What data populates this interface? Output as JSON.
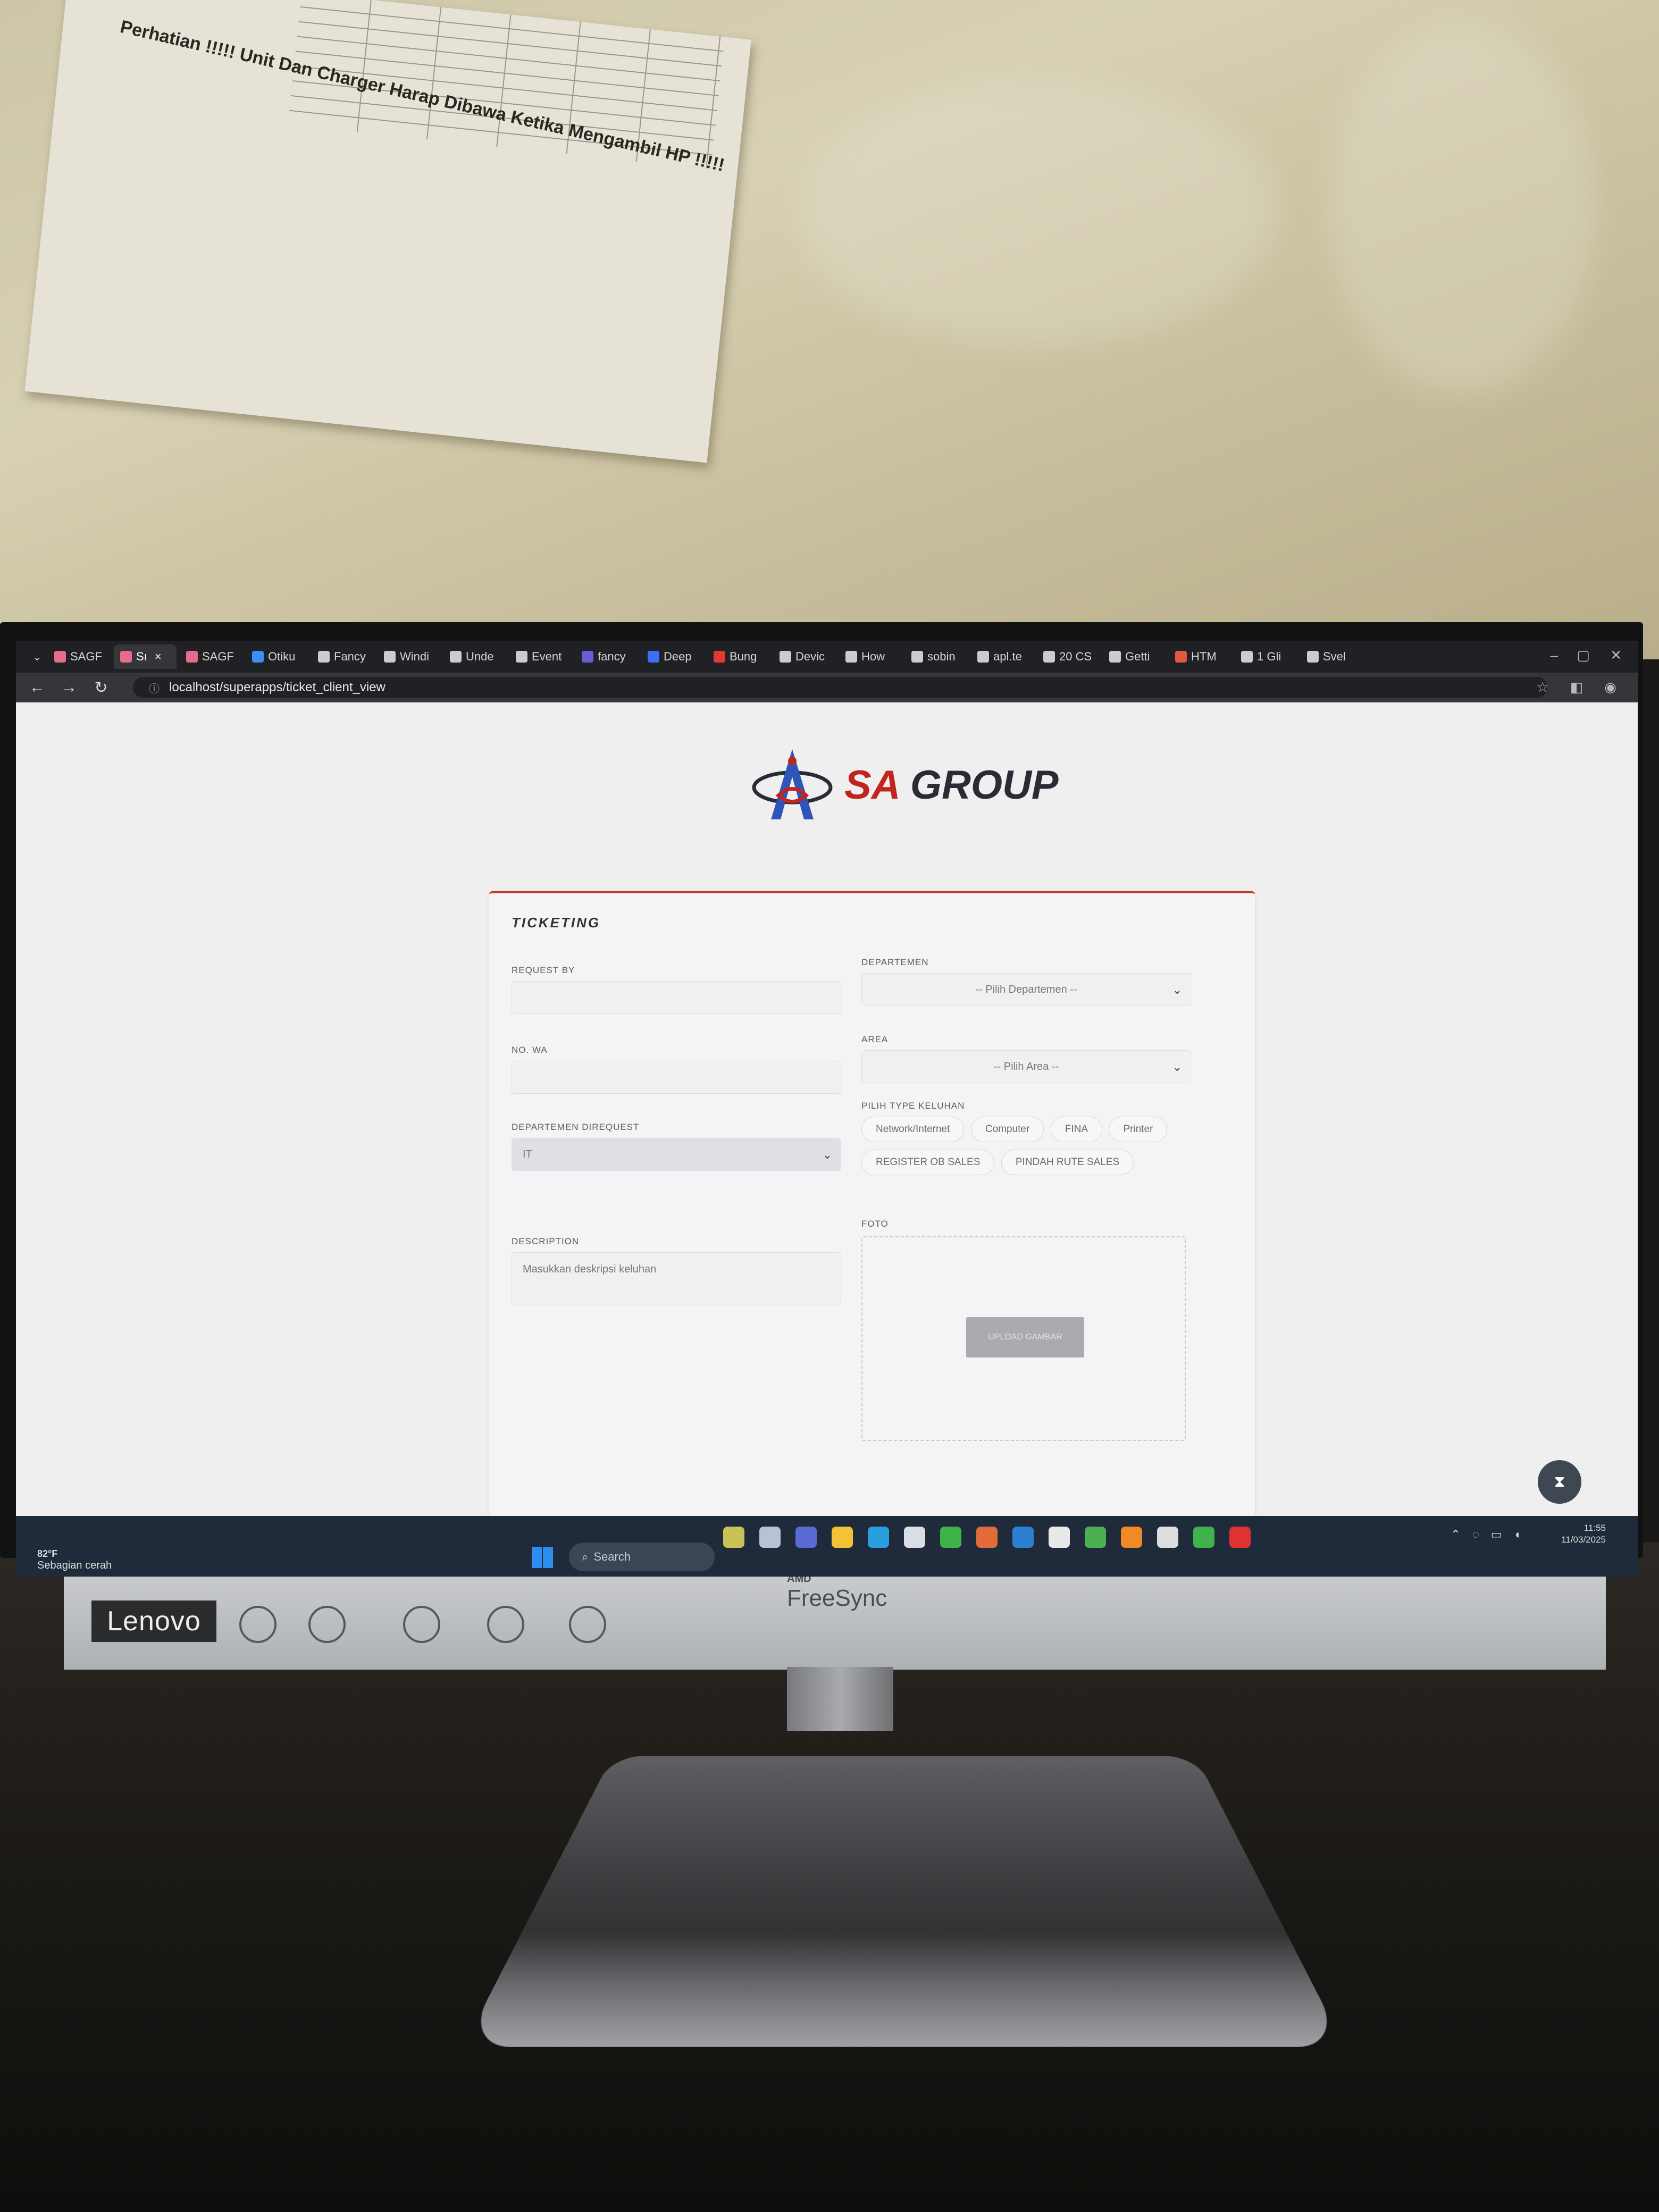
{
  "wall_note": "Perhatian !!!!! Unit Dan Charger Harap Dibawa Ketika Mengambil HP !!!!!",
  "browser": {
    "tabs": [
      {
        "label": "SAGF",
        "color": "#e86b8c"
      },
      {
        "label": "Sı",
        "color": "#e86b8c",
        "active": true
      },
      {
        "label": "SAGF",
        "color": "#e86b8c"
      },
      {
        "label": "Otiku",
        "color": "#3d8ef5"
      },
      {
        "label": "Fancy",
        "color": "#cccccc"
      },
      {
        "label": "Windi",
        "color": "#cccccc"
      },
      {
        "label": "Unde",
        "color": "#cccccc"
      },
      {
        "label": "Event",
        "color": "#cccccc"
      },
      {
        "label": "fancy",
        "color": "#6b5bd6"
      },
      {
        "label": "Deep",
        "color": "#3d6ef5"
      },
      {
        "label": "Bung",
        "color": "#e53935"
      },
      {
        "label": "Devic",
        "color": "#cccccc"
      },
      {
        "label": "How",
        "color": "#cccccc"
      },
      {
        "label": "sobin",
        "color": "#cccccc"
      },
      {
        "label": "apl.te",
        "color": "#cccccc"
      },
      {
        "label": "20 CS",
        "color": "#cccccc"
      },
      {
        "label": "Getti",
        "color": "#cccccc"
      },
      {
        "label": "HTM",
        "color": "#e2583e"
      },
      {
        "label": "1 Gli",
        "color": "#cccccc"
      },
      {
        "label": "Svel",
        "color": "#cccccc"
      }
    ],
    "url": "localhost/superapps/ticket_client_view"
  },
  "logo": {
    "sa": "SA",
    "group": "GROUP"
  },
  "form": {
    "title": "TICKETING",
    "request_by_label": "REQUEST BY",
    "no_wa_label": "NO. WA",
    "departemen_direquest_label": "DEPARTEMEN DIREQUEST",
    "departemen_direquest_value": "IT",
    "description_label": "DESCRIPTION",
    "description_placeholder": "Masukkan deskripsi keluhan",
    "departemen_label": "DEPARTEMEN",
    "departemen_placeholder": "-- Pilih Departemen --",
    "area_label": "AREA",
    "area_placeholder": "-- Pilih Area --",
    "type_keluhan_label": "PILIH TYPE KELUHAN",
    "type_keluhan_options": [
      "Network/Internet",
      "Computer",
      "FINA",
      "Printer",
      "REGISTER OB SALES",
      "PINDAH RUTE SALES"
    ],
    "foto_label": "FOTO",
    "upload_label": "UPLOAD GAMBAR"
  },
  "taskbar": {
    "weather_temp": "82°F",
    "weather_desc": "Sebagian cerah",
    "search_label": "Search",
    "time": "11:55",
    "date": "11/03/2025"
  },
  "monitor": {
    "brand": "Lenovo",
    "freesync": "FreeSync",
    "amd": "AMD"
  }
}
